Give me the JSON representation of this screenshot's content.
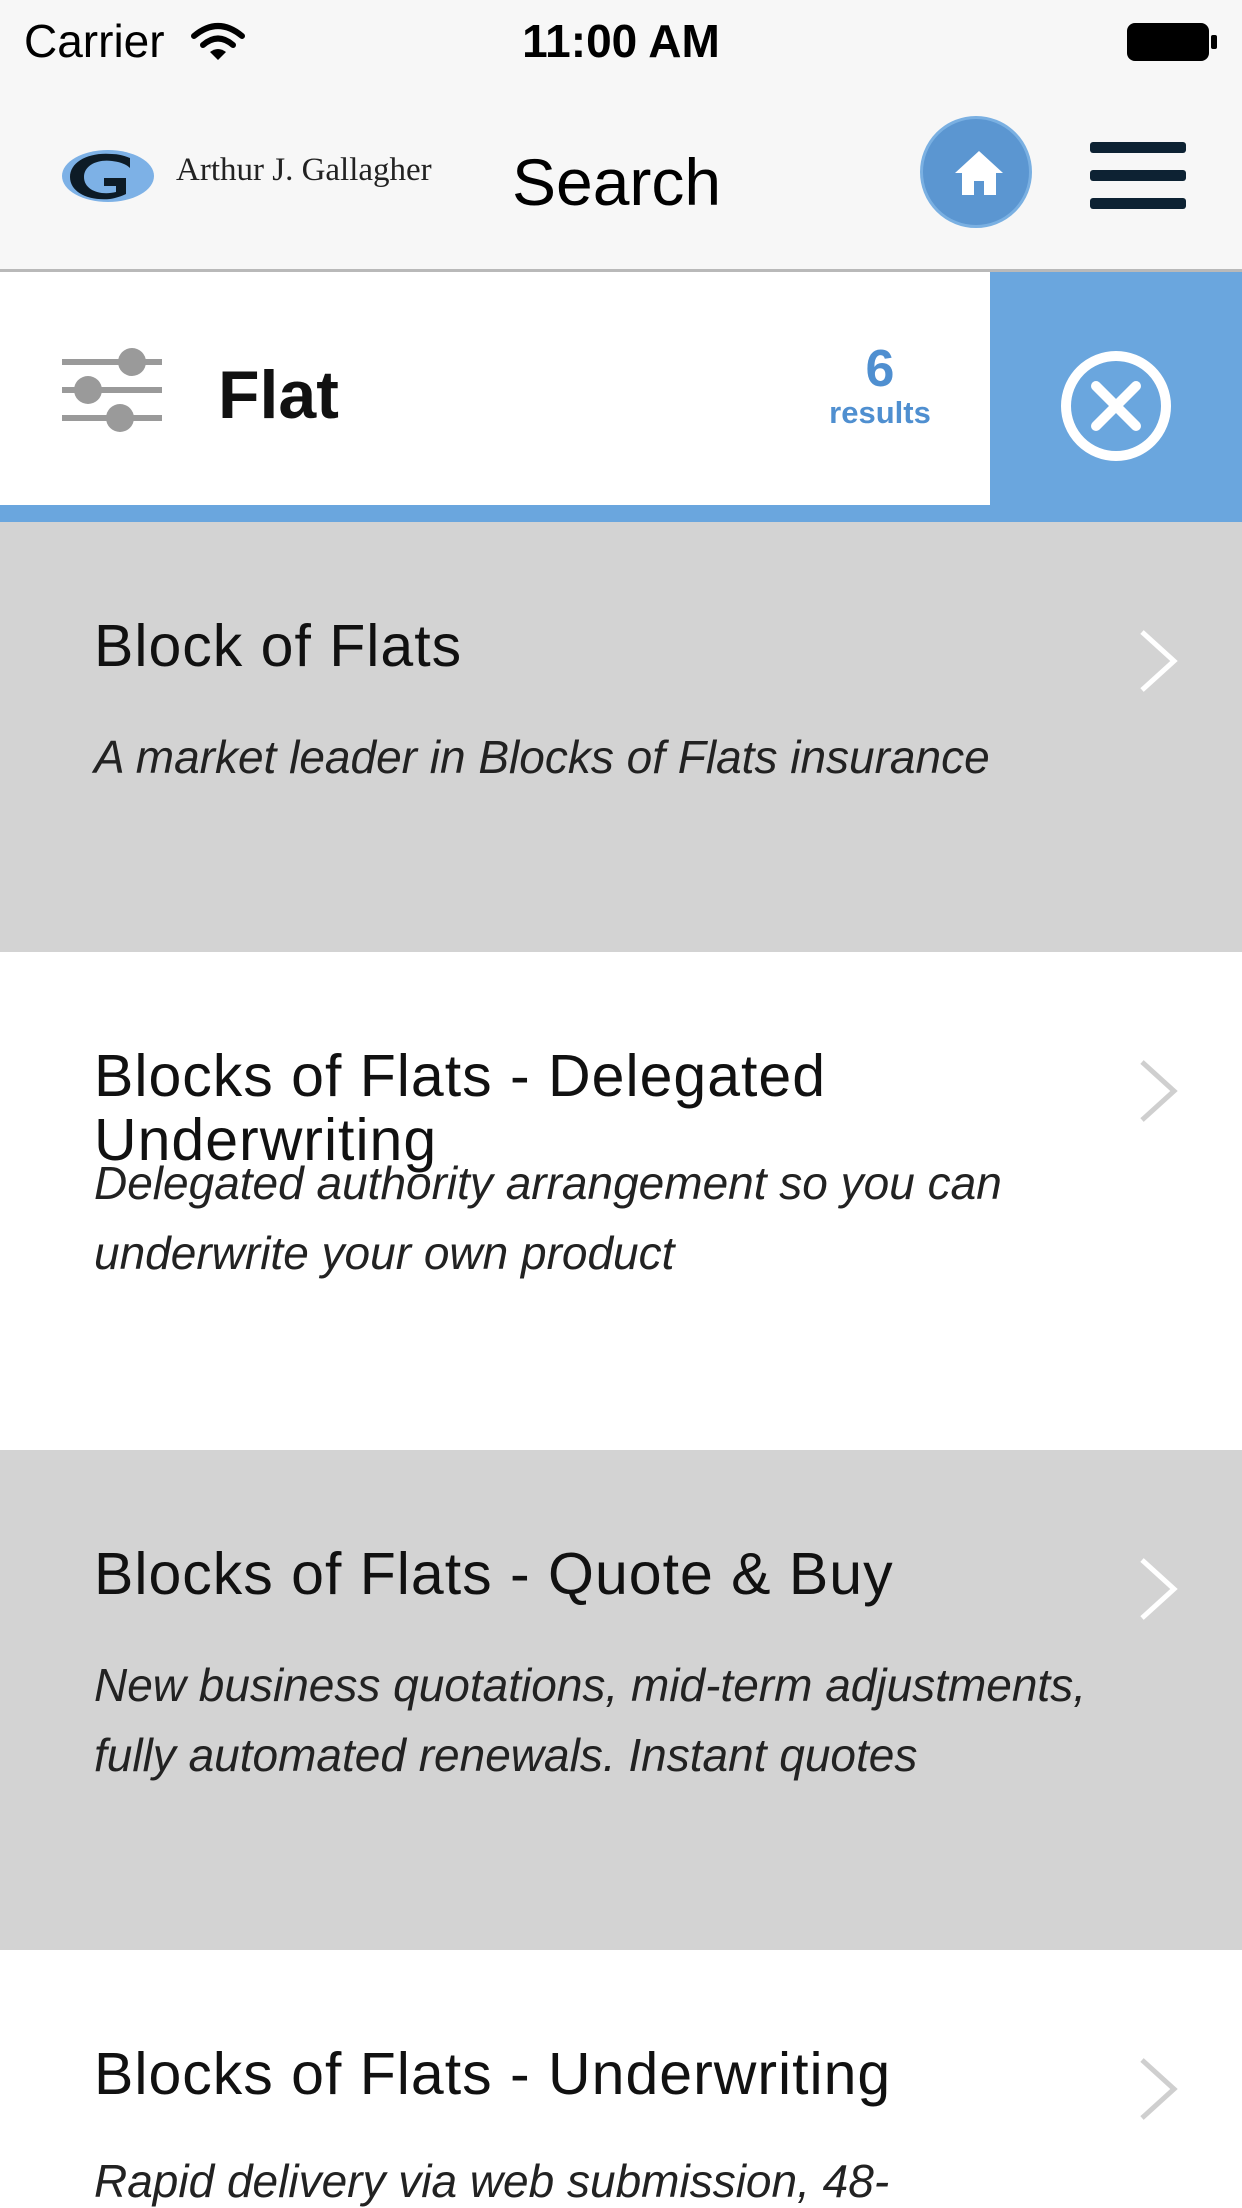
{
  "status_bar": {
    "carrier": "Carrier",
    "time": "11:00 AM",
    "wifi_icon": "wifi-icon",
    "battery_icon": "battery-icon"
  },
  "header": {
    "logo_text": "Arthur J. Gallagher",
    "title": "Search",
    "home_icon": "home-icon",
    "menu_icon": "hamburger-menu-icon"
  },
  "search": {
    "filter_icon": "sliders-icon",
    "term": "Flat",
    "results_count": "6",
    "results_label": "results",
    "clear_icon": "close-circle-icon"
  },
  "colors": {
    "accent_blue": "#6aa6de",
    "count_blue": "#4f8fd0",
    "row_gray": "#d3d3d3",
    "row_white": "#ffffff",
    "menu_navy": "#0d2233"
  },
  "results": [
    {
      "title": "Block of Flats",
      "description": "A market leader in Blocks of Flats insurance"
    },
    {
      "title": "Blocks of Flats - Delegated Underwriting",
      "description": "Delegated authority arrangement so you can underwrite your own product"
    },
    {
      "title": "Blocks of Flats - Quote & Buy",
      "description": "New business quotations, mid-term adjustments, fully automated renewals. Instant quotes"
    },
    {
      "title": "Blocks of Flats - Underwriting",
      "description": "Rapid delivery via web submission, 48-"
    }
  ]
}
